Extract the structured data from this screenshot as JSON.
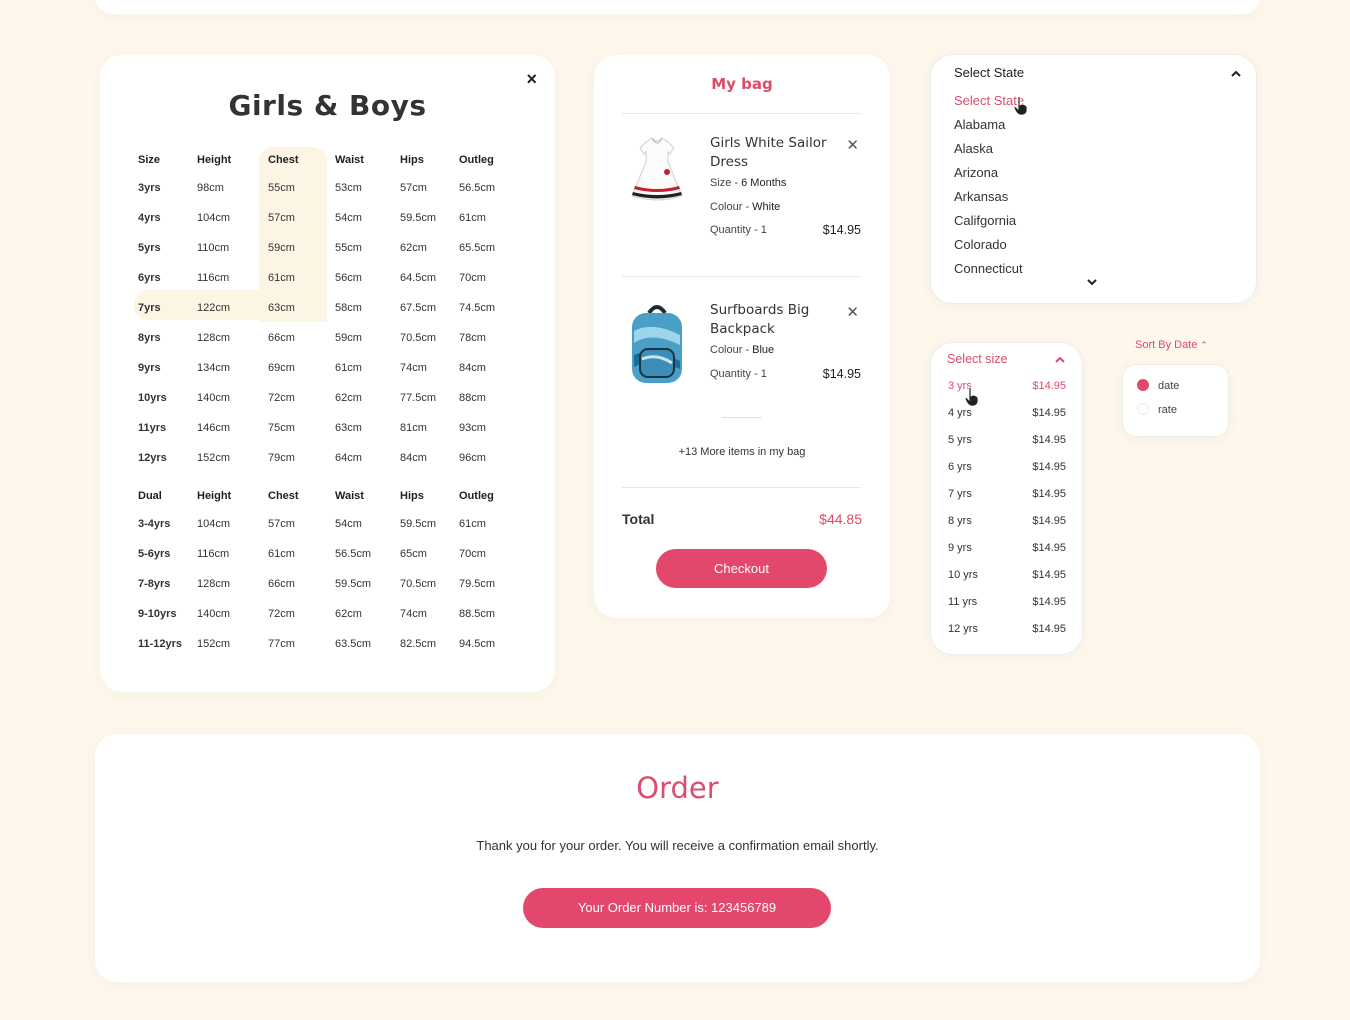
{
  "size_chart": {
    "title": "Girls & Boys",
    "close_icon": "×",
    "single": {
      "headers": [
        "Size",
        "Height",
        "Chest",
        "Waist",
        "Hips",
        "Outleg"
      ],
      "rows": [
        [
          "3yrs",
          "98cm",
          "55cm",
          "53cm",
          "57cm",
          "56.5cm"
        ],
        [
          "4yrs",
          "104cm",
          "57cm",
          "54cm",
          "59.5cm",
          "61cm"
        ],
        [
          "5yrs",
          "110cm",
          "59cm",
          "55cm",
          "62cm",
          "65.5cm"
        ],
        [
          "6yrs",
          "116cm",
          "61cm",
          "56cm",
          "64.5cm",
          "70cm"
        ],
        [
          "7yrs",
          "122cm",
          "63cm",
          "58cm",
          "67.5cm",
          "74.5cm"
        ],
        [
          "8yrs",
          "128cm",
          "66cm",
          "59cm",
          "70.5cm",
          "78cm"
        ],
        [
          "9yrs",
          "134cm",
          "69cm",
          "61cm",
          "74cm",
          "84cm"
        ],
        [
          "10yrs",
          "140cm",
          "72cm",
          "62cm",
          "77.5cm",
          "88cm"
        ],
        [
          "11yrs",
          "146cm",
          "75cm",
          "63cm",
          "81cm",
          "93cm"
        ],
        [
          "12yrs",
          "152cm",
          "79cm",
          "64cm",
          "84cm",
          "96cm"
        ]
      ]
    },
    "dual": {
      "headers": [
        "Dual",
        "Height",
        "Chest",
        "Waist",
        "Hips",
        "Outleg"
      ],
      "rows": [
        [
          "3-4yrs",
          "104cm",
          "57cm",
          "54cm",
          "59.5cm",
          "61cm"
        ],
        [
          "5-6yrs",
          "116cm",
          "61cm",
          "56.5cm",
          "65cm",
          "70cm"
        ],
        [
          "7-8yrs",
          "128cm",
          "66cm",
          "59.5cm",
          "70.5cm",
          "79.5cm"
        ],
        [
          "9-10yrs",
          "140cm",
          "72cm",
          "62cm",
          "74cm",
          "88.5cm"
        ],
        [
          "11-12yrs",
          "152cm",
          "77cm",
          "63.5cm",
          "82.5cm",
          "94.5cm"
        ]
      ]
    }
  },
  "bag": {
    "title": "My bag",
    "items": [
      {
        "name": "Girls White Sailor Dress",
        "size_label": "Size -",
        "size_value": "6 Months",
        "colour_label": "Colour -",
        "colour_value": "White",
        "quantity": "Quantity - 1",
        "price": "$14.95",
        "icon": "dress-icon"
      },
      {
        "name": "Surfboards Big Backpack",
        "colour_label": "Colour -",
        "colour_value": "Blue",
        "quantity": "Quantity - 1",
        "price": "$14.95",
        "icon": "backpack-icon"
      }
    ],
    "more_text": "+13 More items in my bag",
    "total_label": "Total",
    "total_value": "$44.85",
    "checkout_label": "Checkout"
  },
  "state_dropdown": {
    "selected": "Select State",
    "options": [
      "Select State",
      "Alabama",
      "Alaska",
      "Arizona",
      "Arkansas",
      "Califgornia",
      "Colorado",
      "Connecticut"
    ],
    "active_index": 0
  },
  "size_dropdown": {
    "label": "Select size",
    "options": [
      {
        "label": "3 yrs",
        "price": "$14.95"
      },
      {
        "label": "4 yrs",
        "price": "$14.95"
      },
      {
        "label": "5 yrs",
        "price": "$14.95"
      },
      {
        "label": "6 yrs",
        "price": "$14.95"
      },
      {
        "label": "7 yrs",
        "price": "$14.95"
      },
      {
        "label": "8 yrs",
        "price": "$14.95"
      },
      {
        "label": "9 yrs",
        "price": "$14.95"
      },
      {
        "label": "10 yrs",
        "price": "$14.95"
      },
      {
        "label": "11 yrs",
        "price": "$14.95"
      },
      {
        "label": "12 yrs",
        "price": "$14.95"
      }
    ],
    "active_index": 0
  },
  "sort": {
    "label": "Sort By Date",
    "options": [
      "date",
      "rate"
    ],
    "selected_index": 0
  },
  "order": {
    "title": "Order",
    "message": "Thank you for your order. You will receive a confirmation email shortly.",
    "number_label": "Your Order Number is: 123456789"
  },
  "colors": {
    "accent": "#e3486c",
    "background": "#fdf7ec",
    "highlight": "#fdf5e4"
  }
}
